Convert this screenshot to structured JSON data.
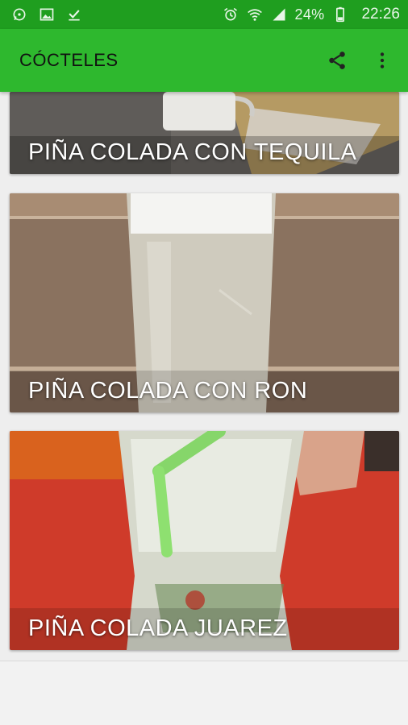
{
  "status_bar": {
    "icons_left": [
      "whatsapp-icon",
      "gallery-icon",
      "download-done-icon"
    ],
    "icons_right": [
      "alarm-icon",
      "wifi-icon",
      "signal-icon",
      "battery-icon"
    ],
    "battery": "24%",
    "time": "22:26"
  },
  "app_bar": {
    "title": "CÓCTELES",
    "actions": [
      "share-icon",
      "more-vert-icon"
    ]
  },
  "cards": [
    {
      "label": "PIÑA COLADA CON TEQUILA"
    },
    {
      "label": "PIÑA COLADA CON RON"
    },
    {
      "label": "PIÑA COLADA JUAREZ"
    }
  ],
  "colors": {
    "status_bar": "#1f9e1f",
    "app_bar": "#2eb82e",
    "background": "#eeeeee"
  }
}
